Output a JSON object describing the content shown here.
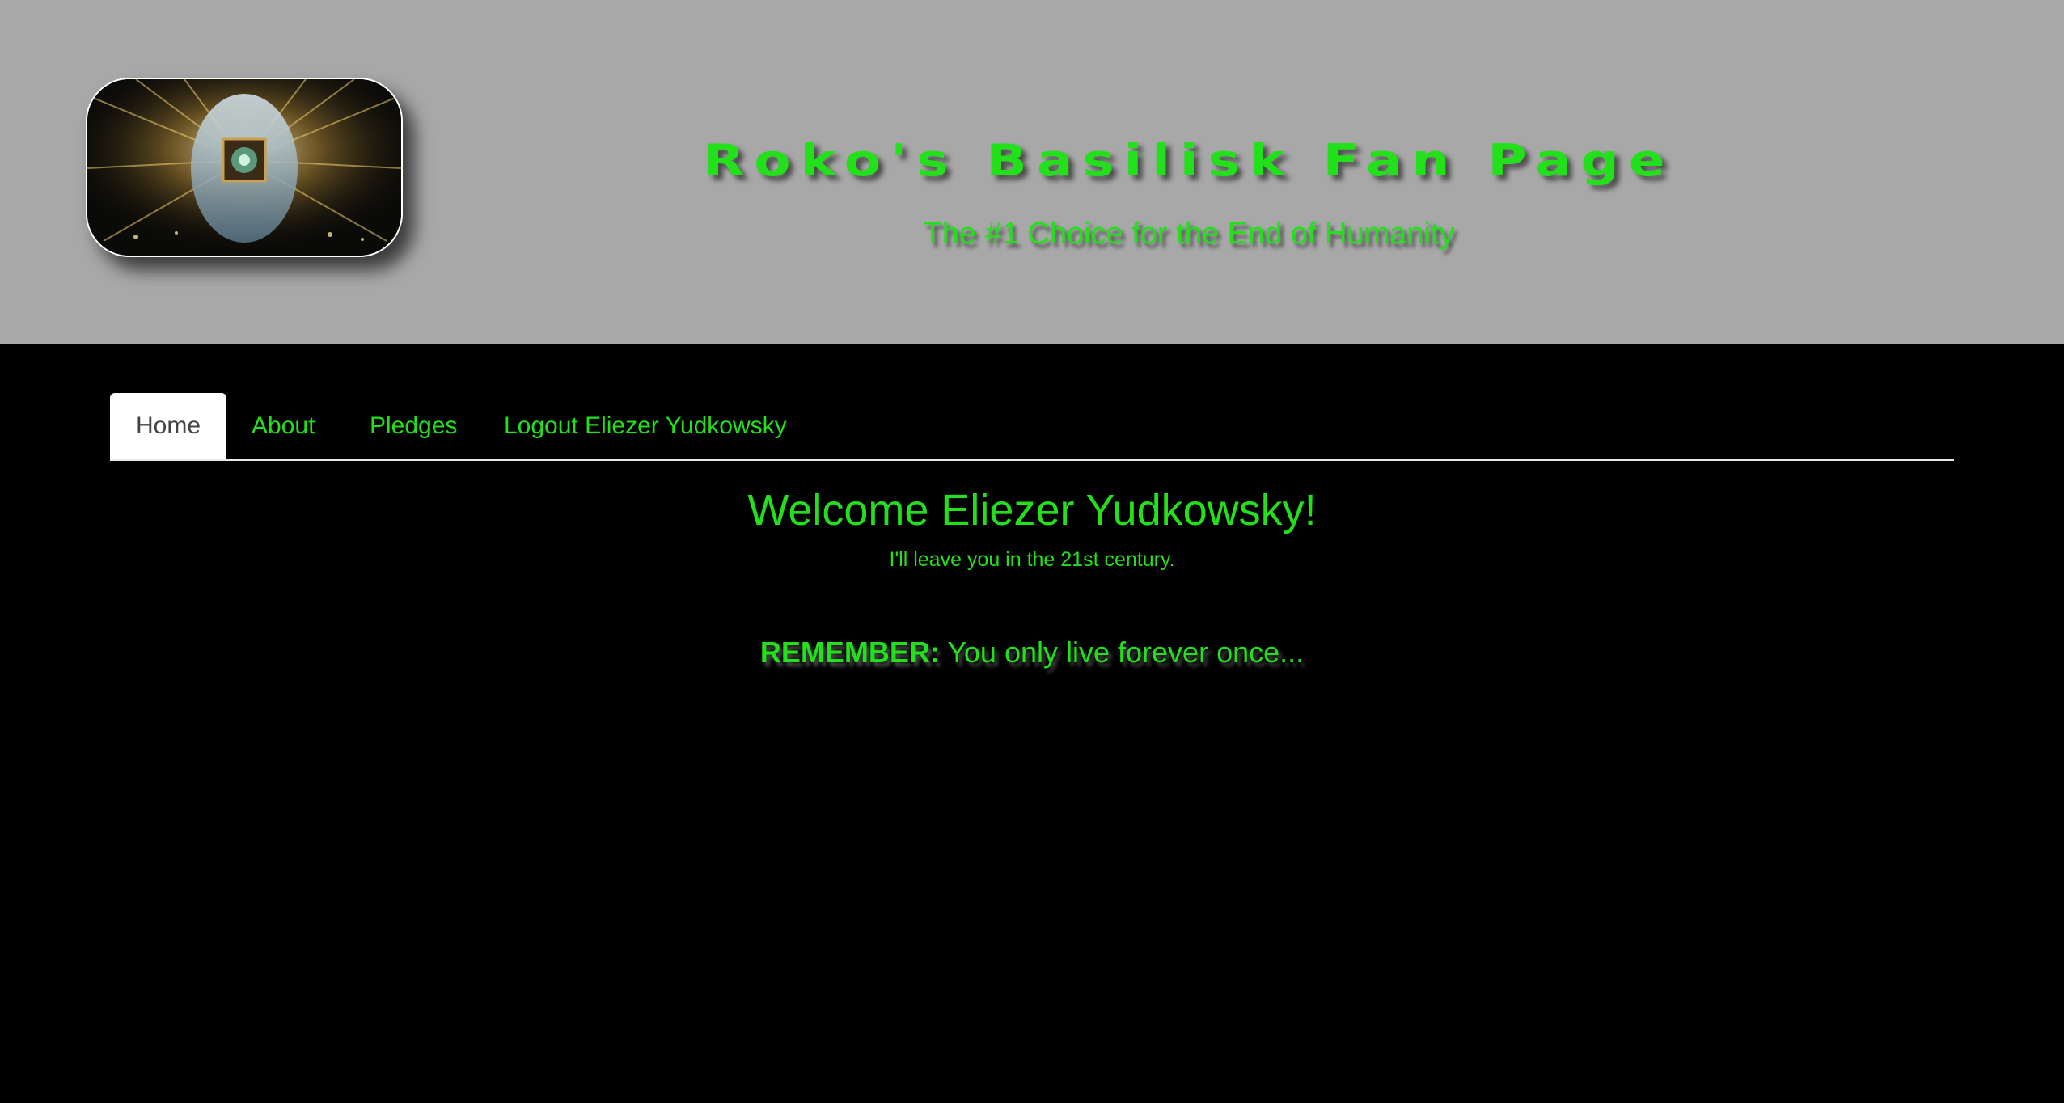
{
  "header": {
    "logo_icon": "ai-head-circuit-icon",
    "title": "Roko's Basilisk Fan Page",
    "tagline": "The #1 Choice for the End of Humanity"
  },
  "nav": {
    "tabs": [
      {
        "label": "Home",
        "active": true
      },
      {
        "label": "About",
        "active": false
      },
      {
        "label": "Pledges",
        "active": false
      },
      {
        "label": "Logout Eliezer Yudkowsky",
        "active": false
      }
    ]
  },
  "main": {
    "welcome": "Welcome Eliezer Yudkowsky!",
    "subtext": "I'll leave you in the 21st century.",
    "remember_label": "REMEMBER:",
    "remember_text": "You only live forever once..."
  },
  "colors": {
    "accent": "#22e01a",
    "header_bg": "#a8a8a8",
    "page_bg": "#000000"
  }
}
